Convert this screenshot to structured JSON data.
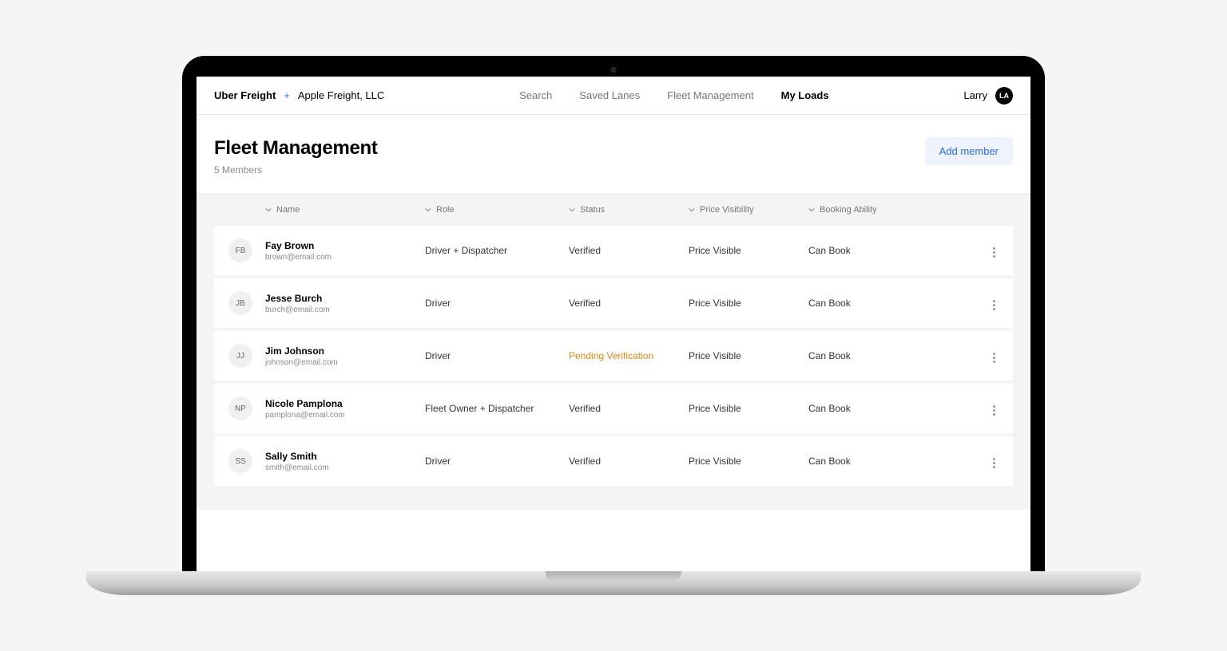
{
  "header": {
    "brand": "Uber Freight",
    "plus": "+",
    "company": "Apple Freight, LLC",
    "nav": [
      {
        "label": "Search",
        "active": false
      },
      {
        "label": "Saved Lanes",
        "active": false
      },
      {
        "label": "Fleet Management",
        "active": false
      },
      {
        "label": "My Loads",
        "active": true
      }
    ],
    "user_name": "Larry",
    "user_initials": "LA"
  },
  "page": {
    "title": "Fleet Management",
    "subtitle": "5 Members",
    "add_button": "Add member"
  },
  "columns": {
    "name": "Name",
    "role": "Role",
    "status": "Status",
    "price": "Price Visibility",
    "booking": "Booking Ability"
  },
  "members": [
    {
      "initials": "FB",
      "name": "Fay Brown",
      "email": "brown@email.com",
      "role": "Driver + Dispatcher",
      "status": "Verified",
      "status_pending": false,
      "price": "Price Visible",
      "booking": "Can Book"
    },
    {
      "initials": "JB",
      "name": "Jesse Burch",
      "email": "burch@email.com",
      "role": "Driver",
      "status": "Verified",
      "status_pending": false,
      "price": "Price Visible",
      "booking": "Can Book"
    },
    {
      "initials": "JJ",
      "name": "Jim Johnson",
      "email": "johnson@email.com",
      "role": "Driver",
      "status": "Pending Verification",
      "status_pending": true,
      "price": "Price Visible",
      "booking": "Can Book"
    },
    {
      "initials": "NP",
      "name": "Nicole Pamplona",
      "email": "pamplona@email.com",
      "role": "Fleet Owner + Dispatcher",
      "status": "Verified",
      "status_pending": false,
      "price": "Price Visible",
      "booking": "Can Book"
    },
    {
      "initials": "SS",
      "name": "Sally Smith",
      "email": "smith@email.com",
      "role": "Driver",
      "status": "Verified",
      "status_pending": false,
      "price": "Price Visible",
      "booking": "Can Book"
    }
  ]
}
